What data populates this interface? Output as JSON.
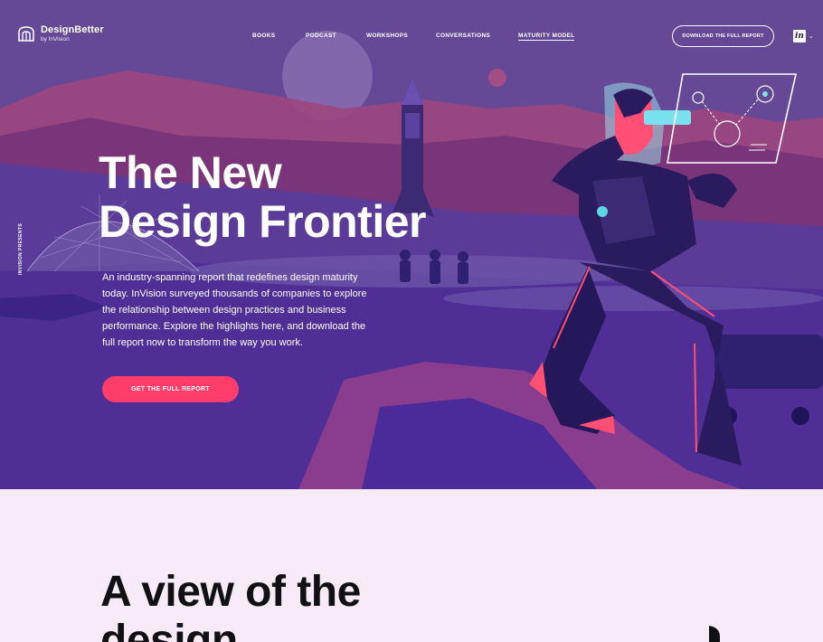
{
  "header": {
    "logo": {
      "title": "DesignBetter",
      "subtitle": "by InVision"
    },
    "nav": [
      {
        "label": "BOOKS",
        "active": false
      },
      {
        "label": "PODCAST",
        "active": false
      },
      {
        "label": "WORKSHOPS",
        "active": false
      },
      {
        "label": "CONVERSATIONS",
        "active": false
      },
      {
        "label": "MATURITY MODEL",
        "active": true
      }
    ],
    "download_label": "DOWNLOAD THE FULL REPORT",
    "brand_badge": "in"
  },
  "hero": {
    "side_label": "INVISION PRESENTS",
    "title_lines": [
      "The New",
      "Design Frontier"
    ],
    "description": "An industry-spanning report that redefines design maturity today. InVision surveyed thousands of companies to explore the relationship between design practices and business performance. Explore the highlights here, and download the full report now to transform the way you work.",
    "cta_label": "GET THE FULL REPORT"
  },
  "section2": {
    "title_lines": [
      "A view of the",
      "design"
    ]
  },
  "colors": {
    "hero_bg": "#5f3f8f",
    "accent": "#ff3d6a",
    "page_bg": "#f6ebf6",
    "text_dark": "#111014"
  }
}
